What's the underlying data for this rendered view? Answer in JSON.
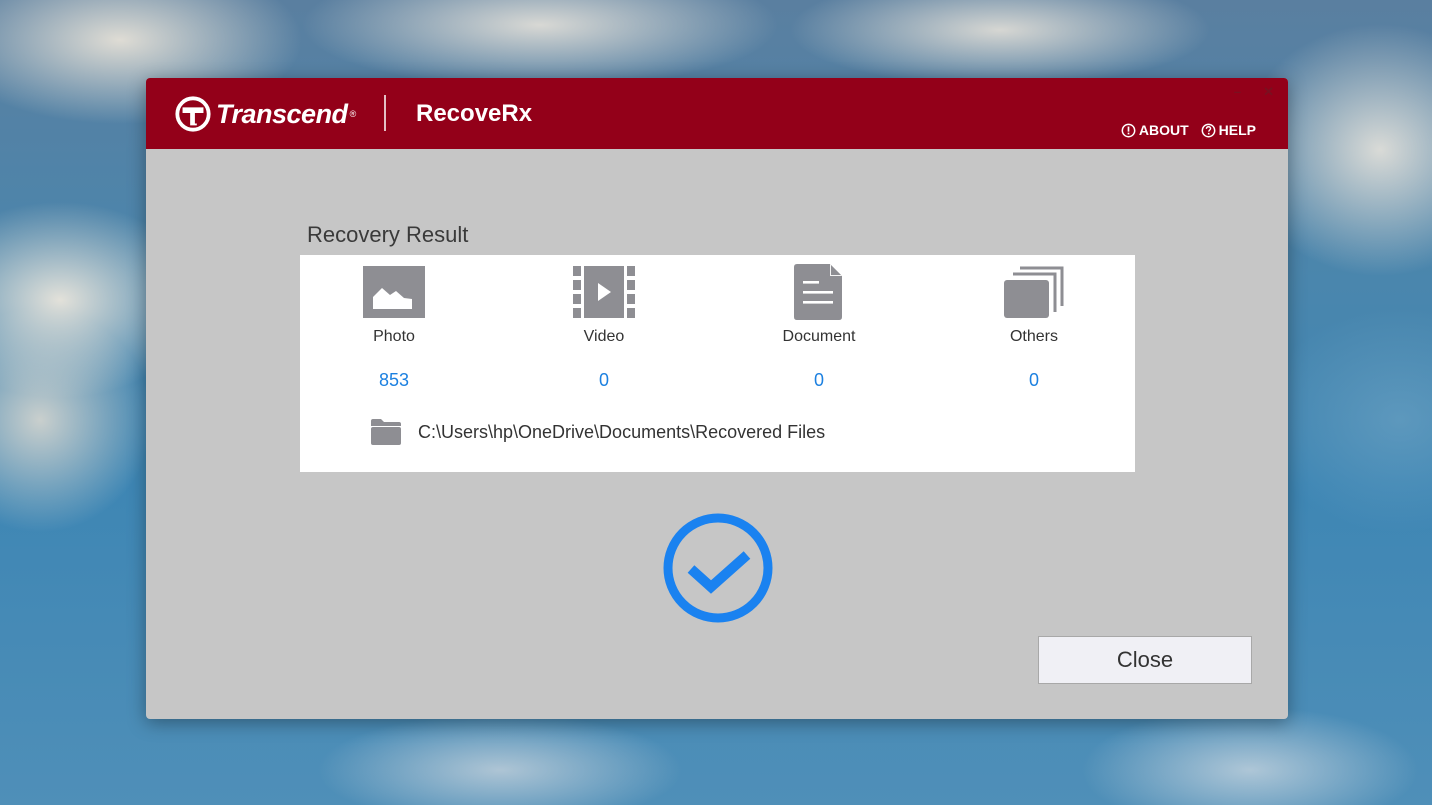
{
  "window": {
    "brand": "Transcend",
    "brand_reg": "®",
    "app_name": "RecoveRx",
    "minimize_icon": "minimize-icon",
    "close_icon": "close-icon",
    "minimize_glyph": "–",
    "close_glyph": "✕",
    "accent_color": "#930019"
  },
  "top_links": {
    "about": {
      "label": "ABOUT",
      "icon": "info-circle-icon"
    },
    "help": {
      "label": "HELP",
      "icon": "question-circle-icon"
    }
  },
  "result": {
    "title": "Recovery Result",
    "categories": [
      {
        "label": "Photo",
        "count": "853",
        "icon": "photo-icon"
      },
      {
        "label": "Video",
        "count": "0",
        "icon": "video-icon"
      },
      {
        "label": "Document",
        "count": "0",
        "icon": "document-icon"
      },
      {
        "label": "Others",
        "count": "0",
        "icon": "others-icon"
      }
    ],
    "path_icon": "folder-icon",
    "path": "C:\\Users\\hp\\OneDrive\\Documents\\Recovered Files",
    "count_color": "#1c80e0"
  },
  "status": {
    "icon": "success-check-icon",
    "color": "#1a82f0"
  },
  "actions": {
    "close_label": "Close"
  }
}
